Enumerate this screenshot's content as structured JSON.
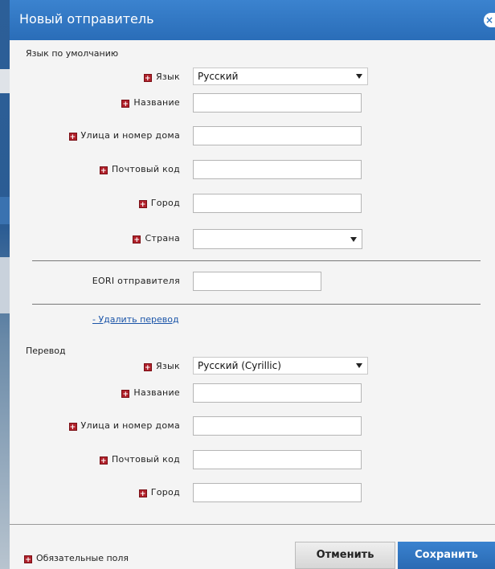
{
  "dialog": {
    "title": "Новый отправитель",
    "close_glyph": "×"
  },
  "default_section": {
    "label": "Язык по умолчанию",
    "language": {
      "label": "Язык",
      "value": "Русский"
    },
    "name": {
      "label": "Название",
      "value": ""
    },
    "street": {
      "label": "Улица и номер дома",
      "value": ""
    },
    "postcode": {
      "label": "Почтовый код",
      "value": ""
    },
    "city": {
      "label": "Город",
      "value": ""
    },
    "country": {
      "label": "Страна",
      "value": ""
    }
  },
  "eori": {
    "label": "EORI отправителя",
    "value": ""
  },
  "remove_translation_link": "- Удалить перевод",
  "translation_section": {
    "label": "Перевод",
    "language": {
      "label": "Язык",
      "value": "Русский (Cyrillic)"
    },
    "name": {
      "label": "Название",
      "value": ""
    },
    "street": {
      "label": "Улица и номер дома",
      "value": ""
    },
    "postcode": {
      "label": "Почтовый код",
      "value": ""
    },
    "city": {
      "label": "Город",
      "value": ""
    }
  },
  "footer": {
    "required_note": "Обязательные поля",
    "cancel_label": "Отменить",
    "save_label": "Сохранить"
  },
  "colors": {
    "titlebar": "#2f78c4",
    "required_marker": "#b0202a",
    "link": "#1a54a8",
    "save_button": "#2f78c4"
  },
  "icons": {
    "required_marker": "required-plus-icon",
    "close": "close-icon",
    "dropdown": "chevron-down-icon"
  }
}
